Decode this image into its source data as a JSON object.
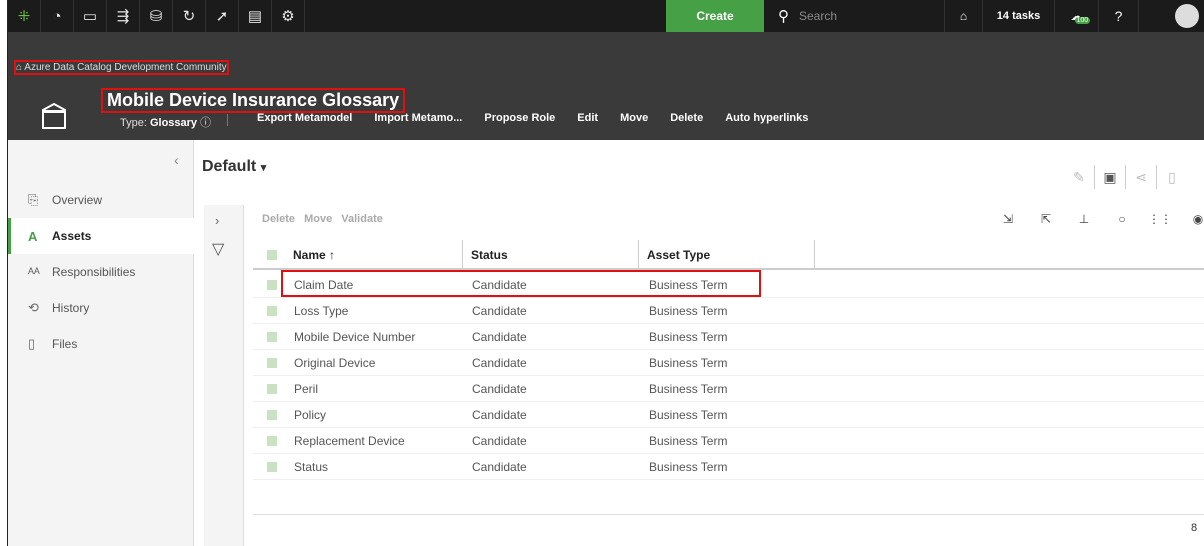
{
  "topnav": {
    "icons": [
      "logo-icon",
      "dashboard-icon",
      "browse-icon",
      "diagram-icon",
      "database-icon",
      "sync-icon",
      "rocket-icon",
      "report-icon",
      "settings-icon"
    ],
    "create_label": "Create",
    "search_placeholder": "Search",
    "tasks_label": "14 tasks",
    "badge": "100"
  },
  "header": {
    "breadcrumb": "Azure Data Catalog Development Community",
    "title": "Mobile Device Insurance Glossary",
    "type_prefix": "Type:",
    "type_value": "Glossary",
    "actions": [
      "Export Metamodel",
      "Import Metamo...",
      "Propose Role",
      "Edit",
      "Move",
      "Delete",
      "Auto hyperlinks"
    ]
  },
  "sidebar": {
    "items": [
      {
        "label": "Overview",
        "icon": "overview-icon",
        "glyph": "⎘"
      },
      {
        "label": "Assets",
        "icon": "assets-icon",
        "glyph": "A"
      },
      {
        "label": "Responsibilities",
        "icon": "responsibilities-icon",
        "glyph": "ᴬᴬ"
      },
      {
        "label": "History",
        "icon": "history-icon",
        "glyph": "⟲"
      },
      {
        "label": "Files",
        "icon": "file-icon",
        "glyph": "▯"
      }
    ],
    "active_index": 1
  },
  "main": {
    "view_name": "Default",
    "bulk_actions": [
      "Delete",
      "Move",
      "Validate"
    ],
    "columns": [
      "Name",
      "Status",
      "Asset Type"
    ],
    "sort_indicator": "↑",
    "rows": [
      {
        "name": "Claim Date",
        "status": "Candidate",
        "type": "Business Term"
      },
      {
        "name": "Loss Type",
        "status": "Candidate",
        "type": "Business Term"
      },
      {
        "name": "Mobile Device Number",
        "status": "Candidate",
        "type": "Business Term"
      },
      {
        "name": "Original Device",
        "status": "Candidate",
        "type": "Business Term"
      },
      {
        "name": "Peril",
        "status": "Candidate",
        "type": "Business Term"
      },
      {
        "name": "Policy",
        "status": "Candidate",
        "type": "Business Term"
      },
      {
        "name": "Replacement Device",
        "status": "Candidate",
        "type": "Business Term"
      },
      {
        "name": "Status",
        "status": "Candidate",
        "type": "Business Term"
      }
    ],
    "total_count": "8"
  }
}
